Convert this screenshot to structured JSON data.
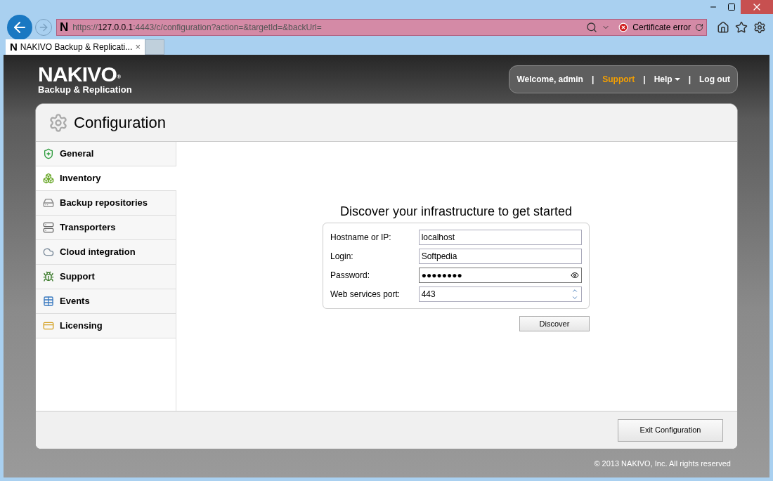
{
  "browser": {
    "address": [
      {
        "text": "https://",
        "emphasis": false
      },
      {
        "text": "127.0.0.1",
        "emphasis": true
      },
      {
        "text": ":4443/c/configuration?action=&targetId=&backUrl=",
        "emphasis": false
      }
    ],
    "site_icon": "N",
    "certificate": "Certificate error",
    "tabs": [
      {
        "icon": "N",
        "title": "NAKIVO Backup & Replicati...",
        "close": "×",
        "selected": true
      }
    ]
  },
  "header": {
    "logo": "NAKIVO",
    "logo_mark": "®",
    "logo_sub": "Backup & Replication",
    "separator": "|",
    "user": [
      {
        "kind": "text",
        "label": "Welcome, admin"
      },
      {
        "kind": "link",
        "label": "Support",
        "highlighted": true
      },
      {
        "kind": "menu",
        "label": "Help"
      },
      {
        "kind": "link",
        "label": "Log out",
        "highlighted": false
      }
    ]
  },
  "panel": {
    "title": "Configuration"
  },
  "sidebar": {
    "items": [
      {
        "kind": "shield",
        "label": "General",
        "selected": false
      },
      {
        "kind": "inventory",
        "label": "Inventory",
        "selected": true
      },
      {
        "kind": "storage",
        "label": "Backup repositories",
        "selected": false
      },
      {
        "kind": "server",
        "label": "Transporters",
        "selected": false
      },
      {
        "kind": "cloud",
        "label": "Cloud integration",
        "selected": false
      },
      {
        "kind": "bug",
        "label": "Support",
        "selected": false
      },
      {
        "kind": "table",
        "label": "Events",
        "selected": false
      },
      {
        "kind": "license",
        "label": "Licensing",
        "selected": false
      }
    ]
  },
  "discover": {
    "heading": "Discover your infrastructure to get started",
    "fields": [
      {
        "kind": "text",
        "label": "Hostname or IP:",
        "value": "localhost"
      },
      {
        "kind": "text",
        "label": "Login:",
        "value": "Softpedia"
      },
      {
        "kind": "password",
        "label": "Password:",
        "value": "●●●●●●●●"
      },
      {
        "kind": "number",
        "label": "Web services port:",
        "value": "443"
      }
    ],
    "button": "Discover"
  },
  "footer": {
    "button": "Exit Configuration",
    "copyright": "© 2013 NAKIVO, Inc. All rights reserved"
  }
}
